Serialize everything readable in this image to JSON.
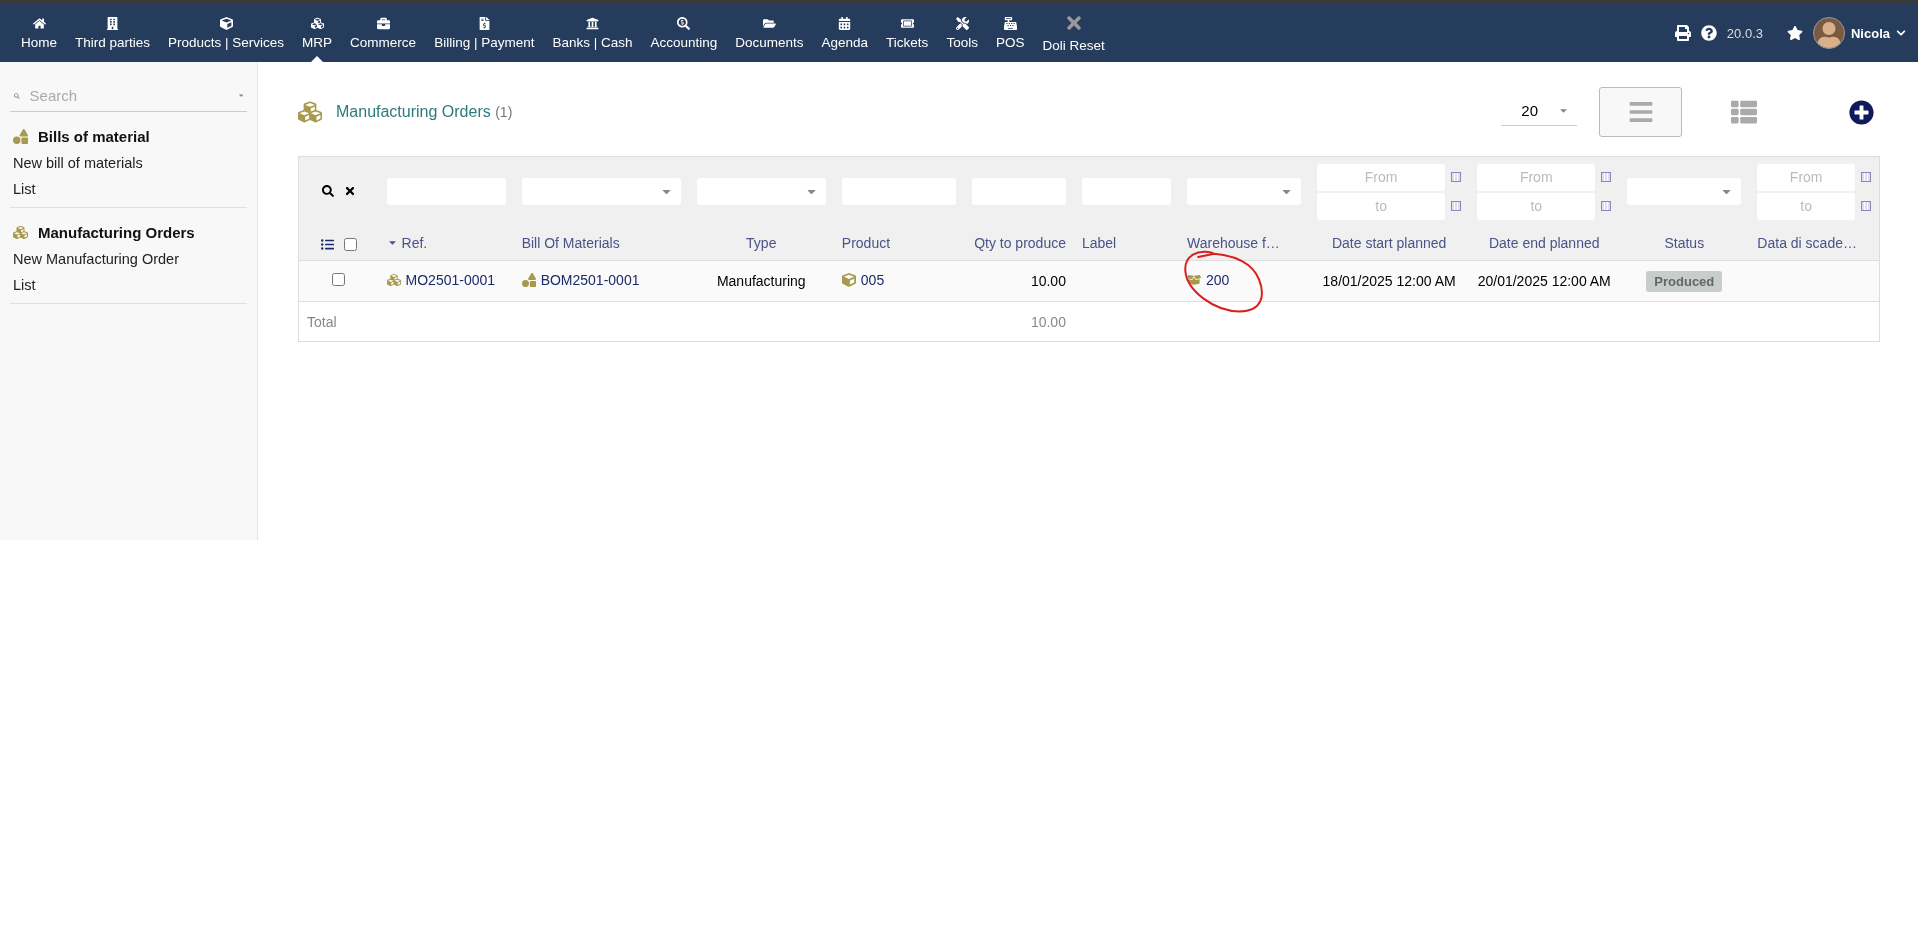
{
  "topbar": {
    "menu": [
      {
        "label": "Home",
        "selected": false
      },
      {
        "label": "Third parties",
        "selected": false
      },
      {
        "label": "Products | Services",
        "selected": false
      },
      {
        "label": "MRP",
        "selected": true
      },
      {
        "label": "Commerce",
        "selected": false
      },
      {
        "label": "Billing | Payment",
        "selected": false
      },
      {
        "label": "Banks | Cash",
        "selected": false
      },
      {
        "label": "Accounting",
        "selected": false
      },
      {
        "label": "Documents",
        "selected": false
      },
      {
        "label": "Agenda",
        "selected": false
      },
      {
        "label": "Tickets",
        "selected": false
      },
      {
        "label": "Tools",
        "selected": false
      },
      {
        "label": "POS",
        "selected": false
      },
      {
        "label": "Doli Reset",
        "selected": false
      }
    ],
    "version": "20.0.3",
    "user": "Nicola"
  },
  "sidebar": {
    "search": {
      "placeholder": "Search"
    },
    "sections": [
      {
        "title": "Bills of material",
        "items": [
          "New bill of materials",
          "List"
        ]
      },
      {
        "title": "Manufacturing Orders",
        "items": [
          "New Manufacturing Order",
          "List"
        ]
      }
    ]
  },
  "page": {
    "title": "Manufacturing Orders",
    "count": "(1)",
    "page_size": "20",
    "view_modes": [
      {
        "kind": "list",
        "selected": true
      },
      {
        "kind": "kanban",
        "selected": false
      }
    ]
  },
  "table": {
    "filters": [
      {
        "kind": "text"
      },
      {
        "kind": "select"
      },
      {
        "kind": "select"
      },
      {
        "kind": "text"
      },
      {
        "kind": "text"
      },
      {
        "kind": "text"
      },
      {
        "kind": "select"
      },
      {
        "kind": "range",
        "from_placeholder": "From",
        "to_placeholder": "to"
      },
      {
        "kind": "range",
        "from_placeholder": "From",
        "to_placeholder": "to"
      },
      {
        "kind": "select"
      },
      {
        "kind": "range",
        "from_placeholder": "From",
        "to_placeholder": "to"
      }
    ],
    "select_all_checked": false,
    "columns": [
      {
        "label": "Ref.",
        "sorted": true
      },
      {
        "label": "Bill Of Materials",
        "sorted": false
      },
      {
        "label": "Type",
        "sorted": false
      },
      {
        "label": "Product",
        "sorted": false
      },
      {
        "label": "Qty to produce",
        "sorted": false
      },
      {
        "label": "Label",
        "sorted": false
      },
      {
        "label": "Warehouse f…",
        "sorted": false
      },
      {
        "label": "Date start planned",
        "sorted": false
      },
      {
        "label": "Date end planned",
        "sorted": false
      },
      {
        "label": "Status",
        "sorted": false
      },
      {
        "label": "Data di scade…",
        "sorted": false
      }
    ],
    "rows": [
      {
        "checked": false,
        "cells": [
          {
            "kind": "mo",
            "text": "MO2501-0001"
          },
          {
            "kind": "bom",
            "text": "BOM2501-0001"
          },
          {
            "kind": "text",
            "text": "Manufacturing"
          },
          {
            "kind": "product",
            "text": "005"
          },
          {
            "kind": "text",
            "text": "10.00"
          },
          {
            "kind": "empty"
          },
          {
            "kind": "warehouse",
            "text": "200",
            "annotated": true
          },
          {
            "kind": "text",
            "text": "18/01/2025 12:00 AM"
          },
          {
            "kind": "text",
            "text": "20/01/2025 12:00 AM"
          },
          {
            "kind": "badge",
            "text": "Produced"
          },
          {
            "kind": "empty"
          }
        ]
      }
    ],
    "total": {
      "label": "Total",
      "qty": "10.00"
    }
  }
}
